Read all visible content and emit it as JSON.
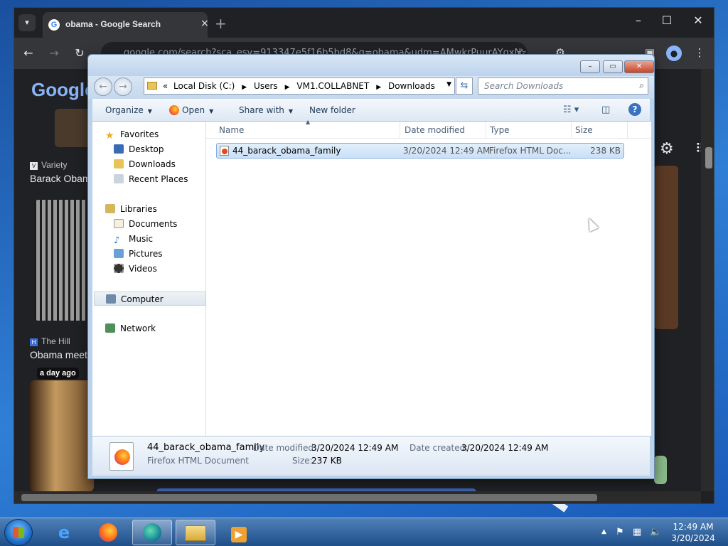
{
  "browser": {
    "tab_title": "obama - Google Search",
    "url": "google.com/search?sca_esv=913347e5f16b5bd8&q=obama&udm=AMwkrPuurAYqxN",
    "tab_close": "×",
    "new_tab": "+",
    "logo_text": "Google",
    "results": [
      {
        "source": "Variety",
        "headline": "Barack Obam"
      },
      {
        "source": "The Hill",
        "headline": "Obama meet"
      }
    ],
    "time_badge": "a day ago"
  },
  "explorer": {
    "breadcrumb": [
      "Local Disk (C:)",
      "Users",
      "VM1.COLLABNET",
      "Downloads"
    ],
    "breadcrumb_prefix": "«",
    "search_placeholder": "Search Downloads",
    "toolbar": {
      "organize": "Organize",
      "open": "Open",
      "share_with": "Share with",
      "new_folder": "New folder"
    },
    "nav": {
      "favorites": "Favorites",
      "desktop": "Desktop",
      "downloads": "Downloads",
      "recent": "Recent Places",
      "libraries": "Libraries",
      "documents": "Documents",
      "music": "Music",
      "pictures": "Pictures",
      "videos": "Videos",
      "computer": "Computer",
      "network": "Network"
    },
    "columns": {
      "name": "Name",
      "date": "Date modified",
      "type": "Type",
      "size": "Size"
    },
    "files": [
      {
        "name": "44_barack_obama_family",
        "date": "3/20/2024 12:49 AM",
        "type": "Firefox HTML Doc...",
        "size": "238 KB"
      }
    ],
    "details": {
      "name": "44_barack_obama_family",
      "type": "Firefox HTML Document",
      "date_modified_label": "Date modified:",
      "date_modified": "3/20/2024 12:49 AM",
      "date_created_label": "Date created:",
      "date_created": "3/20/2024 12:49 AM",
      "size_label": "Size:",
      "size": "237 KB"
    }
  },
  "taskbar": {
    "time": "12:49 AM",
    "date": "3/20/2024"
  }
}
